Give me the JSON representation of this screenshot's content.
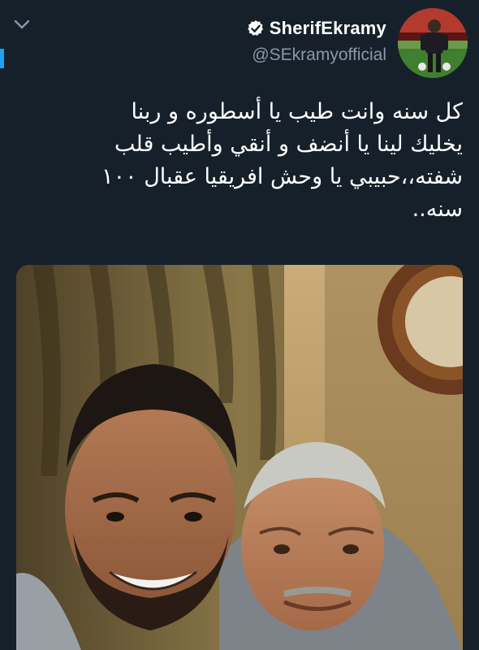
{
  "user": {
    "display_name": "SherifEkramy",
    "handle": "@SEkramyofficial",
    "verified": true
  },
  "tweet": {
    "lines": [
      "كل سنه وانت طيب يا أسطوره و ربنا",
      "يخليك لينا يا أنضف و أنقي وأطيب قلب",
      "شفته،،حبيبي يا وحش افريقيا عقبال ١٠٠",
      "سنه.."
    ]
  },
  "icons": {
    "menu": "chevron-down-icon",
    "verified": "verified-badge-icon"
  },
  "colors": {
    "background": "#15202b",
    "text": "#ffffff",
    "secondary_text": "#8899a6",
    "accent": "#1da1f2"
  }
}
